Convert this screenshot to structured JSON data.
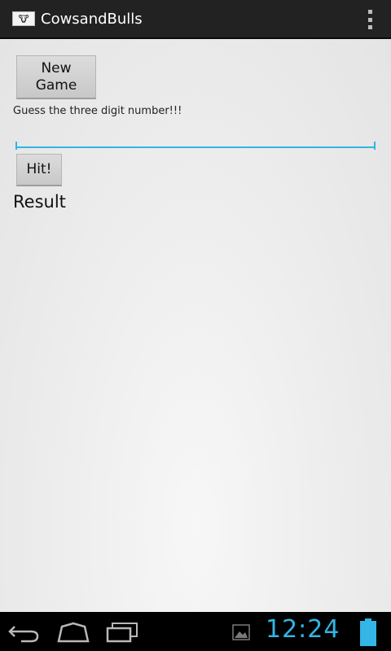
{
  "action_bar": {
    "title": "CowsandBulls",
    "app_icon": "cows-and-bulls-logo-icon",
    "overflow_icon": "overflow-menu-icon"
  },
  "main": {
    "new_game_label": "New Game",
    "prompt": "Guess the three digit number!!!",
    "guess_value": "",
    "guess_placeholder": "",
    "hit_label": "Hit!",
    "result_label": "Result"
  },
  "nav_bar": {
    "back_icon": "back-icon",
    "home_icon": "home-icon",
    "recent_icon": "recent-apps-icon",
    "gallery_icon": "gallery-notification-icon",
    "clock": "12:24",
    "battery_icon": "battery-icon"
  },
  "colors": {
    "accent": "#33b5e5",
    "action_bar": "#222222",
    "background": "#e8e8e8"
  }
}
